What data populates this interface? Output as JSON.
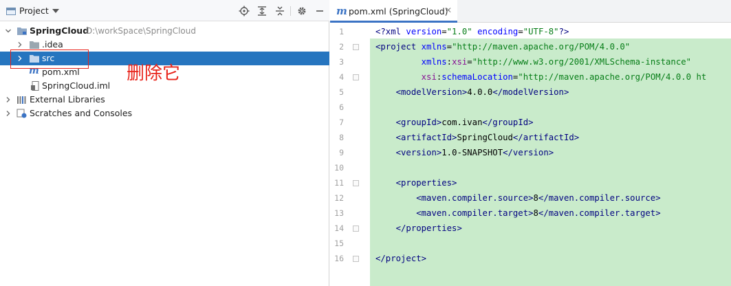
{
  "project_panel": {
    "title": "Project",
    "tree": [
      {
        "label": "SpringCloud",
        "path": "D:\\workSpace\\SpringCloud",
        "icon": "module-folder-icon"
      },
      {
        "label": ".idea",
        "icon": "folder-icon"
      },
      {
        "label": "src",
        "icon": "folder-icon",
        "selected": true
      },
      {
        "label": "pom.xml",
        "icon": "maven-icon"
      },
      {
        "label": "SpringCloud.iml",
        "icon": "iml-file-icon"
      },
      {
        "label": "External Libraries",
        "icon": "libraries-icon"
      },
      {
        "label": "Scratches and Consoles",
        "icon": "scratches-icon"
      }
    ],
    "annotation": "删除它"
  },
  "editor": {
    "tab": {
      "label": "pom.xml (SpringCloud)",
      "icon": "maven-icon"
    },
    "line_numbers": [
      "1",
      "2",
      "3",
      "4",
      "5",
      "6",
      "7",
      "8",
      "9",
      "10",
      "11",
      "12",
      "13",
      "14",
      "15",
      "16"
    ],
    "lines": [
      [
        {
          "t": "<?xml ",
          "c": "tag"
        },
        {
          "t": "version",
          "c": "attr"
        },
        {
          "t": "=",
          "c": "text"
        },
        {
          "t": "\"1.0\"",
          "c": "val"
        },
        {
          "t": " ",
          "c": "text"
        },
        {
          "t": "encoding",
          "c": "attr"
        },
        {
          "t": "=",
          "c": "text"
        },
        {
          "t": "\"UTF-8\"",
          "c": "val"
        },
        {
          "t": "?>",
          "c": "tag"
        }
      ],
      [
        {
          "t": "<project ",
          "c": "tag"
        },
        {
          "t": "xmlns",
          "c": "attr"
        },
        {
          "t": "=",
          "c": "text"
        },
        {
          "t": "\"http://maven.apache.org/POM/4.0.0\"",
          "c": "val"
        }
      ],
      [
        {
          "t": "         ",
          "c": "text"
        },
        {
          "t": "xmlns",
          "c": "attr"
        },
        {
          "t": ":",
          "c": "text"
        },
        {
          "t": "xsi",
          "c": "ns"
        },
        {
          "t": "=",
          "c": "text"
        },
        {
          "t": "\"http://www.w3.org/2001/XMLSchema-instance\"",
          "c": "val"
        }
      ],
      [
        {
          "t": "         ",
          "c": "text"
        },
        {
          "t": "xsi",
          "c": "ns"
        },
        {
          "t": ":",
          "c": "text"
        },
        {
          "t": "schemaLocation",
          "c": "attr"
        },
        {
          "t": "=",
          "c": "text"
        },
        {
          "t": "\"http://maven.apache.org/POM/4.0.0 ht",
          "c": "val"
        }
      ],
      [
        {
          "t": "    ",
          "c": "text"
        },
        {
          "t": "<modelVersion>",
          "c": "tag"
        },
        {
          "t": "4.0.0",
          "c": "text"
        },
        {
          "t": "</modelVersion>",
          "c": "tag"
        }
      ],
      [],
      [
        {
          "t": "    ",
          "c": "text"
        },
        {
          "t": "<groupId>",
          "c": "tag"
        },
        {
          "t": "com.ivan",
          "c": "text"
        },
        {
          "t": "</groupId>",
          "c": "tag"
        }
      ],
      [
        {
          "t": "    ",
          "c": "text"
        },
        {
          "t": "<artifactId>",
          "c": "tag"
        },
        {
          "t": "SpringCloud",
          "c": "text"
        },
        {
          "t": "</artifactId>",
          "c": "tag"
        }
      ],
      [
        {
          "t": "    ",
          "c": "text"
        },
        {
          "t": "<version>",
          "c": "tag"
        },
        {
          "t": "1.0-SNAPSHOT",
          "c": "text"
        },
        {
          "t": "</version>",
          "c": "tag"
        }
      ],
      [],
      [
        {
          "t": "    ",
          "c": "text"
        },
        {
          "t": "<properties>",
          "c": "tag"
        }
      ],
      [
        {
          "t": "        ",
          "c": "text"
        },
        {
          "t": "<maven.compiler.source>",
          "c": "tag"
        },
        {
          "t": "8",
          "c": "text"
        },
        {
          "t": "</maven.compiler.source>",
          "c": "tag"
        }
      ],
      [
        {
          "t": "        ",
          "c": "text"
        },
        {
          "t": "<maven.compiler.target>",
          "c": "tag"
        },
        {
          "t": "8",
          "c": "text"
        },
        {
          "t": "</maven.compiler.target>",
          "c": "tag"
        }
      ],
      [
        {
          "t": "    ",
          "c": "text"
        },
        {
          "t": "</properties>",
          "c": "tag"
        }
      ],
      [],
      [
        {
          "t": "</project>",
          "c": "tag"
        }
      ]
    ]
  }
}
